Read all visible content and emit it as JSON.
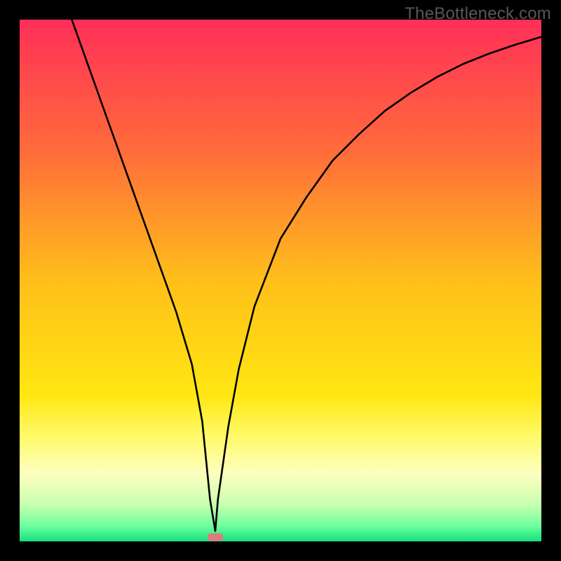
{
  "watermark": "TheBottleneck.com",
  "chart_data": {
    "type": "line",
    "title": "",
    "xlabel": "",
    "ylabel": "",
    "xlim": [
      0,
      100
    ],
    "ylim": [
      0,
      100
    ],
    "series": [
      {
        "name": "bottleneck-curve",
        "x": [
          0,
          2,
          5,
          10,
          15,
          20,
          25,
          30,
          33,
          35,
          36.5,
          37.5,
          38,
          40,
          42,
          45,
          50,
          55,
          60,
          65,
          70,
          75,
          80,
          85,
          90,
          95,
          100
        ],
        "y": [
          130,
          122,
          114,
          100,
          86,
          72,
          58,
          44,
          34,
          23,
          8,
          2,
          8,
          22,
          33,
          45,
          58,
          66,
          73,
          78,
          82.5,
          86,
          89,
          91.5,
          93.5,
          95.2,
          96.7
        ]
      }
    ],
    "marker": {
      "name": "optimal-point",
      "x": 37.5,
      "y": 0.8,
      "color": "#d97d7d"
    },
    "background_gradient": {
      "stops": [
        {
          "offset": 0.0,
          "color": "#ff2f58"
        },
        {
          "offset": 0.25,
          "color": "#ff6b3b"
        },
        {
          "offset": 0.5,
          "color": "#ffbf1a"
        },
        {
          "offset": 0.72,
          "color": "#ffe712"
        },
        {
          "offset": 0.8,
          "color": "#fffa6a"
        },
        {
          "offset": 0.87,
          "color": "#fdffc0"
        },
        {
          "offset": 0.93,
          "color": "#c8ffb0"
        },
        {
          "offset": 0.97,
          "color": "#6eff9e"
        },
        {
          "offset": 1.0,
          "color": "#16e07e"
        }
      ]
    }
  }
}
